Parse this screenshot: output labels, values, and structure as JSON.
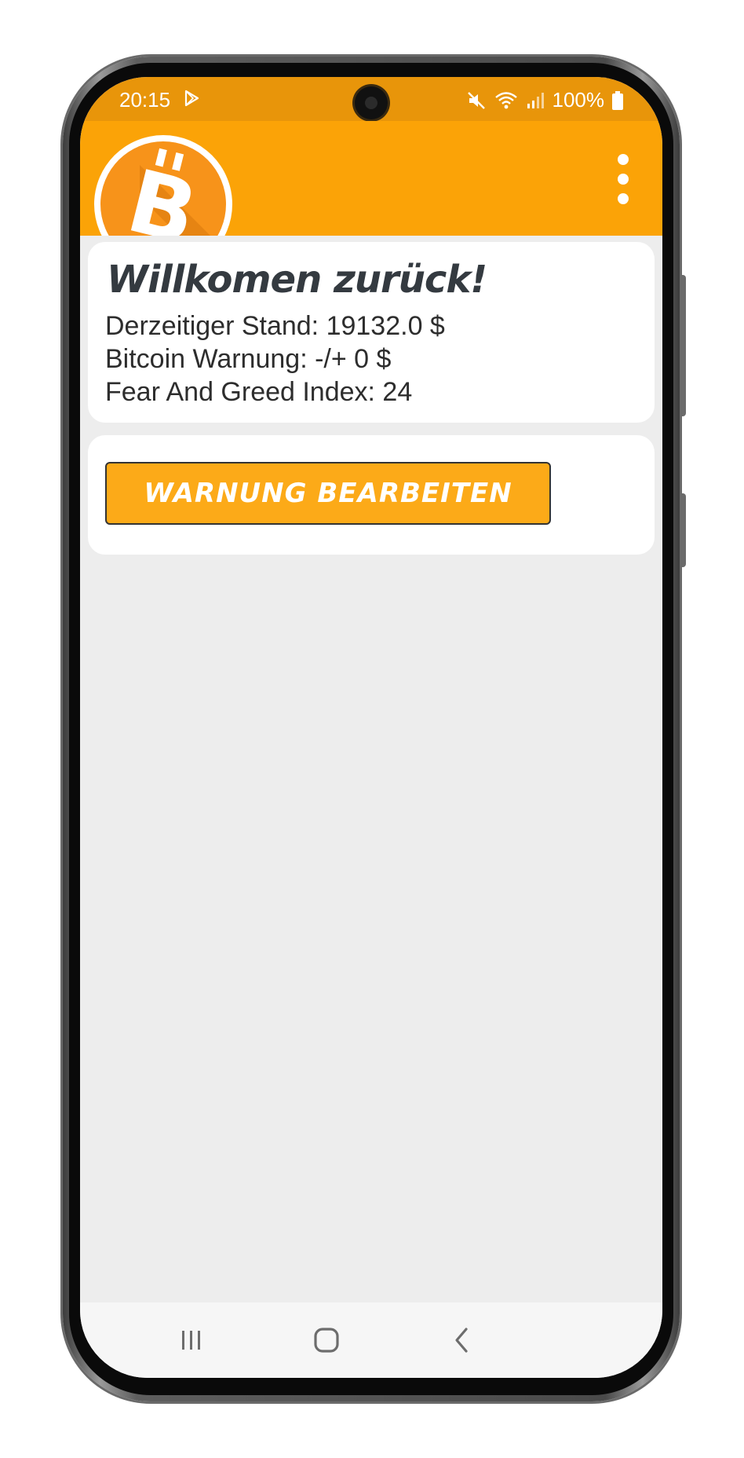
{
  "status_bar": {
    "time": "20:15",
    "battery": "100%",
    "icons": [
      "play-store-icon",
      "mute-icon",
      "wifi-icon",
      "signal-icon",
      "battery-icon"
    ]
  },
  "app_bar": {
    "logo": "bitcoin-logo",
    "menu_icon": "more-vert-icon",
    "color": "#fba307"
  },
  "welcome": {
    "title": "Willkomen zurück!",
    "current_price": "Derzeitiger Stand: 19132.0 $",
    "warning": "Bitcoin Warnung: -/+ 0 $",
    "fear_greed": "Fear And Greed Index: 24"
  },
  "actions": {
    "edit_warning_label": "WARNUNG BEARBEITEN",
    "button_color": "#fcaa18"
  },
  "nav_bar": {
    "icons": [
      "recent-apps-icon",
      "home-icon",
      "back-icon"
    ]
  }
}
